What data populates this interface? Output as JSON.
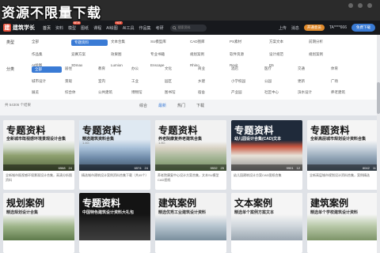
{
  "overlay_title": "资源不限量下载",
  "navbar": {
    "logo_mark": "建",
    "logo_text": "建筑学长",
    "items": [
      {
        "label": "首页",
        "active": true,
        "badge": ""
      },
      {
        "label": "资料",
        "active": false,
        "badge": ""
      },
      {
        "label": "模型",
        "active": false,
        "badge": "NEW"
      },
      {
        "label": "图纸",
        "active": false,
        "badge": ""
      },
      {
        "label": "课程",
        "active": false,
        "badge": ""
      },
      {
        "label": "AI绘图",
        "active": false,
        "badge": "HOT"
      },
      {
        "label": "AI工具",
        "active": false,
        "badge": ""
      },
      {
        "label": "作品集",
        "active": false,
        "badge": ""
      },
      {
        "label": "考研",
        "active": false,
        "badge": ""
      }
    ],
    "search_placeholder": "搜索资料",
    "links": [
      "上传",
      "消息"
    ],
    "vip_label": "开通会员",
    "user_label": "TA****666",
    "upload_label": "免费下载"
  },
  "filters": {
    "type_label": "类型",
    "type_chips": [
      "全部",
      "专题资料",
      "文本合集",
      "SU模型库",
      "CAD图库",
      "PS素材",
      "方案文本",
      "前期分析",
      "作品集",
      "竞赛方案",
      "效果图",
      "专业书籍",
      "规划案例",
      "软件资源",
      "设计规范",
      "规划案例",
      "AI绘图",
      "3Dmax",
      "Lumion",
      "Enscape",
      "Rhino",
      "Revit",
      "D5"
    ],
    "category_label": "分类",
    "category_chips": [
      "全部",
      "居住",
      "教育",
      "办公",
      "文化",
      "商业",
      "酒店",
      "医疗",
      "交通",
      "体育",
      "城市设计",
      "景观",
      "室内",
      "工业",
      "园区",
      "乡建",
      "小学校园",
      "公园",
      "更新",
      "广场",
      "展览",
      "综合体",
      "公共建筑",
      "博物馆",
      "图书馆",
      "宿舍",
      "产业园",
      "社区中心",
      "滨水设计",
      "养老建筑"
    ]
  },
  "sort_bar": {
    "count_text": "共 54306 个结果",
    "items": [
      {
        "label": "综合",
        "active": false
      },
      {
        "label": "最新",
        "active": true
      },
      {
        "label": "热门",
        "active": false
      },
      {
        "label": "下载",
        "active": false
      }
    ]
  },
  "cards_row1": [
    {
      "title": "专题资料",
      "subtitle": "全新城市既视感环境景观设计合集",
      "meta": "",
      "stats": [
        "6568",
        "24"
      ],
      "desc": "全新城市既视感环境景观设计合集，高清分析图资料",
      "theme": "light"
    },
    {
      "title": "专题资料",
      "subtitle": "精选建筑资料合集",
      "meta": "1.4G",
      "stats": [
        "6574",
        "24"
      ],
      "desc": "精选城市建筑设计案例资料合集下载（共45个）",
      "theme": "light"
    },
    {
      "title": "专题资料",
      "subtitle": "养老院康复养老建筑合集",
      "meta": "1.8G",
      "stats": [
        "5532",
        "25"
      ],
      "desc": "养老院康复中心设计方案合集，文本SU模型CAD图纸",
      "theme": "light"
    },
    {
      "title": "专题资料",
      "subtitle": "幼儿园设计合集(CAD)文本",
      "meta": "",
      "stats": [
        "9901",
        "12"
      ],
      "desc": "幼儿园建筑设计方案CAD图纸合集",
      "theme": "dark"
    },
    {
      "title": "专题资料",
      "subtitle": "全新高层城市规划设计资料合集",
      "meta": "",
      "stats": [
        "6042",
        "11"
      ],
      "desc": "全新高层城市规划设计资料合集，案例精选",
      "theme": "light"
    }
  ],
  "cards_row2": [
    {
      "title": "规划案例",
      "subtitle": "精选规划设计合集",
      "theme": "light"
    },
    {
      "title": "专题资料",
      "subtitle": "中国特色建筑设计资料大礼包",
      "theme": "dark"
    },
    {
      "title": "建筑案例",
      "subtitle": "精选优秀工业建筑设计资料",
      "theme": "light"
    },
    {
      "title": "文本案例",
      "subtitle": "精选单个案例方案文本",
      "theme": "light"
    },
    {
      "title": "建筑案例",
      "subtitle": "精选单个学校建筑设计资料",
      "theme": "light"
    }
  ],
  "colors": {
    "accent": "#3a7bd5",
    "navbar": "#17191d",
    "vip": "#e08a2c"
  }
}
